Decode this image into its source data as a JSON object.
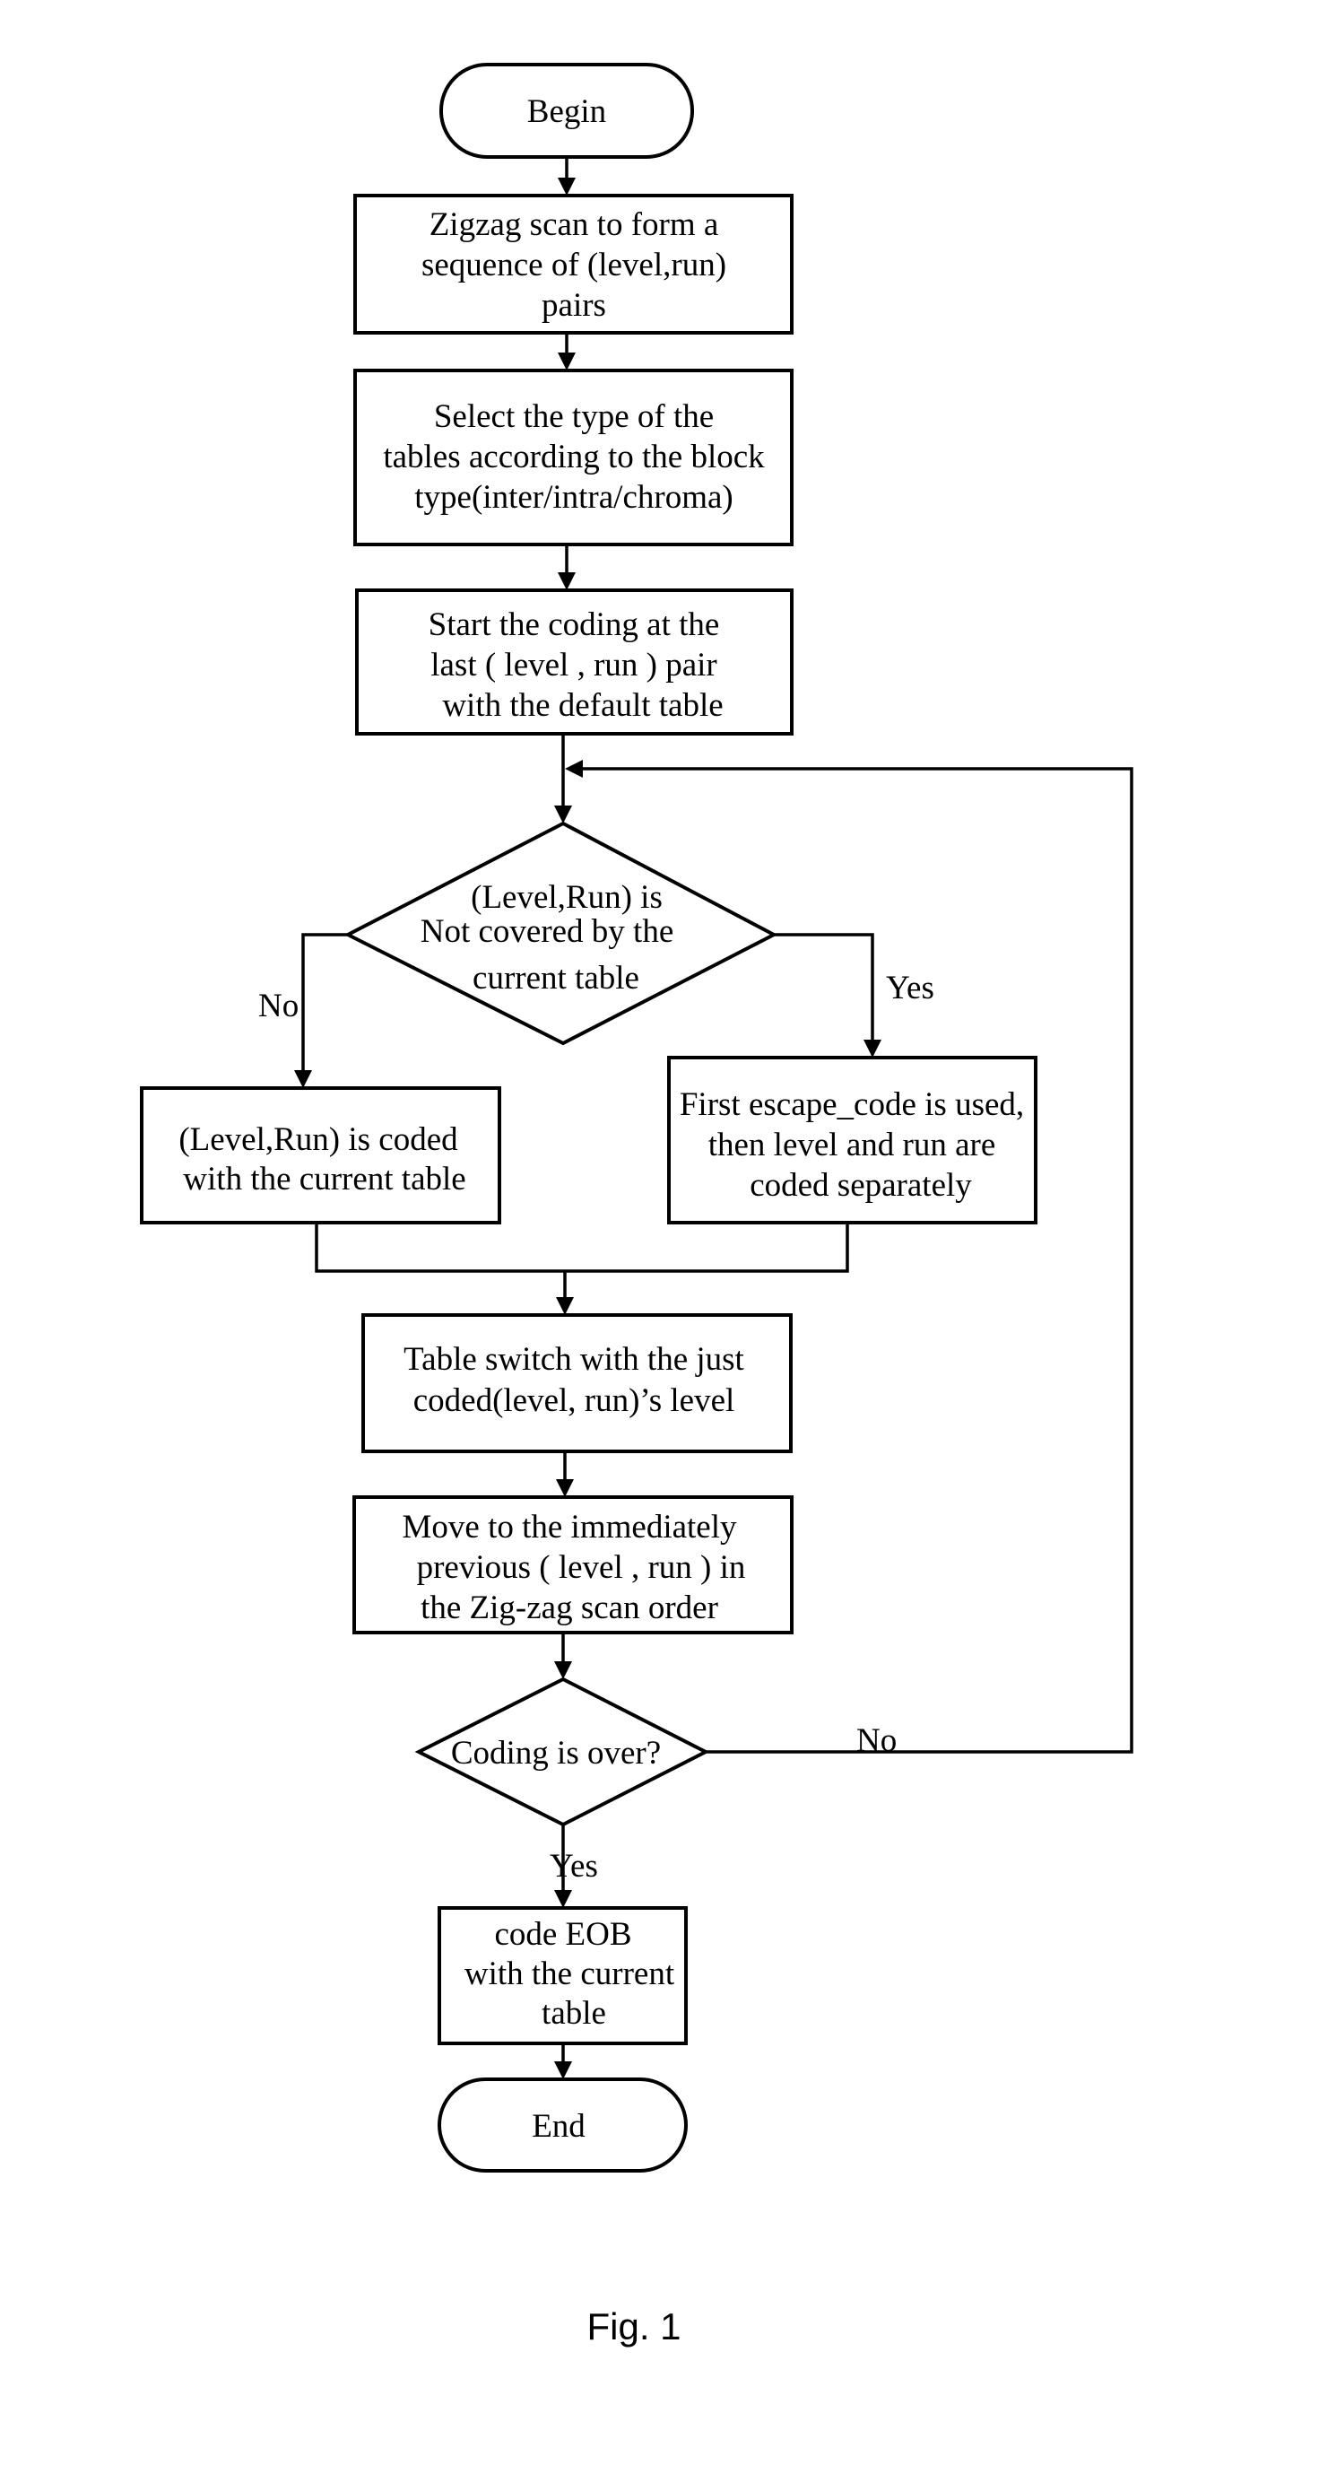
{
  "figure": {
    "caption": "Fig. 1",
    "nodes": {
      "begin": {
        "type": "terminator",
        "lines": [
          "Begin"
        ]
      },
      "zigzag": {
        "type": "process",
        "lines": [
          "Zigzag scan to form a",
          "sequence of (level,run)",
          "pairs"
        ]
      },
      "select_tables": {
        "type": "process",
        "lines": [
          "Select the type of the",
          "tables according to the block",
          "type(inter/intra/chroma)"
        ]
      },
      "start_coding": {
        "type": "process",
        "lines": [
          "Start the coding at the",
          "last ( level , run ) pair",
          "with the default table"
        ]
      },
      "not_covered": {
        "type": "decision",
        "lines": [
          "(Level,Run) is",
          "Not covered by the",
          "current table"
        ]
      },
      "coded_current": {
        "type": "process",
        "lines": [
          "(Level,Run) is coded",
          "with the current table"
        ]
      },
      "escape_code": {
        "type": "process",
        "lines": [
          "First escape_code is used,",
          "then level and run are",
          "coded separately"
        ]
      },
      "table_switch": {
        "type": "process",
        "lines": [
          "Table switch with the just",
          "coded(level, run)’s level"
        ]
      },
      "move_previous": {
        "type": "process",
        "lines": [
          "Move to the immediately",
          "previous ( level , run ) in",
          "the Zig-zag scan order"
        ]
      },
      "coding_over": {
        "type": "decision",
        "lines": [
          "Coding is over?"
        ]
      },
      "code_eob": {
        "type": "process",
        "lines": [
          "code EOB",
          "with the current",
          "table"
        ]
      },
      "end": {
        "type": "terminator",
        "lines": [
          "End"
        ]
      }
    },
    "edge_labels": {
      "not_covered_no": "No",
      "not_covered_yes": "Yes",
      "coding_over_no": "No",
      "coding_over_yes": "Yes"
    },
    "edges": [
      {
        "from": "begin",
        "to": "zigzag"
      },
      {
        "from": "zigzag",
        "to": "select_tables"
      },
      {
        "from": "select_tables",
        "to": "start_coding"
      },
      {
        "from": "start_coding",
        "to": "not_covered"
      },
      {
        "from": "not_covered",
        "to": "coded_current",
        "label": "No"
      },
      {
        "from": "not_covered",
        "to": "escape_code",
        "label": "Yes"
      },
      {
        "from": "coded_current",
        "to": "table_switch"
      },
      {
        "from": "escape_code",
        "to": "table_switch"
      },
      {
        "from": "table_switch",
        "to": "move_previous"
      },
      {
        "from": "move_previous",
        "to": "coding_over"
      },
      {
        "from": "coding_over",
        "to": "not_covered",
        "label": "No"
      },
      {
        "from": "coding_over",
        "to": "code_eob",
        "label": "Yes"
      },
      {
        "from": "code_eob",
        "to": "end"
      }
    ]
  }
}
